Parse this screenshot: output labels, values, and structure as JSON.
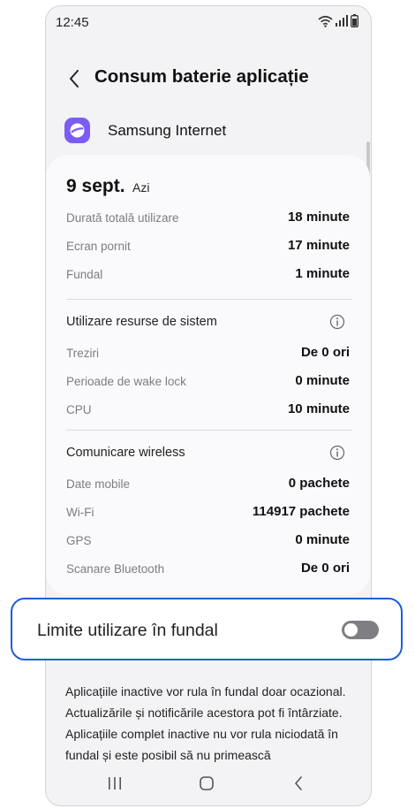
{
  "status_bar": {
    "time": "12:45",
    "icons": [
      "wifi-icon",
      "signal-icon",
      "battery-icon"
    ]
  },
  "header": {
    "title": "Consum baterie aplicație",
    "back_icon": "chevron-left-icon"
  },
  "app": {
    "name": "Samsung Internet",
    "icon": "samsung-internet-icon",
    "icon_color": "#7b5cf5"
  },
  "usage": {
    "date": "9 sept.",
    "date_note": "Azi",
    "rows": [
      {
        "label": "Durată totală utilizare",
        "value": "18 minute"
      },
      {
        "label": "Ecran pornit",
        "value": "17 minute"
      },
      {
        "label": "Fundal",
        "value": "1 minute"
      }
    ]
  },
  "system_resources": {
    "title": "Utilizare resurse de sistem",
    "info_icon": "info-icon",
    "rows": [
      {
        "label": "Treziri",
        "value": "De 0 ori"
      },
      {
        "label": "Perioade de wake lock",
        "value": "0 minute"
      },
      {
        "label": "CPU",
        "value": "10 minute"
      }
    ]
  },
  "wireless": {
    "title": "Comunicare wireless",
    "info_icon": "info-icon",
    "rows": [
      {
        "label": "Date mobile",
        "value": "0 pachete"
      },
      {
        "label": "Wi-Fi",
        "value": "114917 pachete"
      },
      {
        "label": "GPS",
        "value": "0 minute"
      },
      {
        "label": "Scanare Bluetooth",
        "value": "De 0 ori"
      }
    ]
  },
  "background_limit": {
    "label": "Limite utilizare în fundal",
    "enabled": false,
    "highlight_color": "#1a5fd7"
  },
  "description": "Aplicațiile inactive vor rula în fundal doar ocazional. Actualizările și notificările acestora pot fi întârziate. Aplicațiile complet inactive nu vor rula niciodată în fundal și este posibil să nu primească",
  "nav_bar": {
    "icons": [
      "recent-apps-icon",
      "home-icon",
      "back-icon"
    ]
  }
}
